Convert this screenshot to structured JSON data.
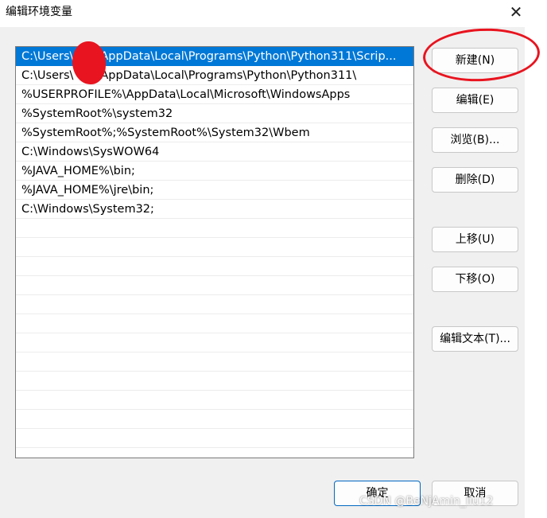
{
  "window": {
    "title": "编辑环境变量",
    "close_glyph": "✕"
  },
  "path_list": {
    "items": [
      "C:\\Users\\",
      "C:\\Users\\",
      "%USERPROFILE%\\AppData\\Local\\Microsoft\\WindowsApps",
      "%SystemRoot%\\system32",
      "%SystemRoot%;%SystemRoot%\\System32\\Wbem",
      "C:\\Windows\\SysWOW64",
      "%JAVA_HOME%\\bin;",
      "%JAVA_HOME%\\jre\\bin;",
      "C:\\Windows\\System32;"
    ],
    "item_suffixes": [
      "AppData\\Local\\Programs\\Python\\Python311\\Scrip...",
      "AppData\\Local\\Programs\\Python\\Python311\\"
    ],
    "selected_index": 0
  },
  "buttons": {
    "new": "新建(N)",
    "edit": "编辑(E)",
    "browse": "浏览(B)...",
    "delete": "删除(D)",
    "move_up": "上移(U)",
    "move_down": "下移(O)",
    "edit_text": "编辑文本(T)...",
    "ok": "确定",
    "cancel": "取消"
  },
  "annotations": {
    "highlight_color": "#e8141f"
  },
  "watermark": "CSDN @BeNjAmin_liu12"
}
